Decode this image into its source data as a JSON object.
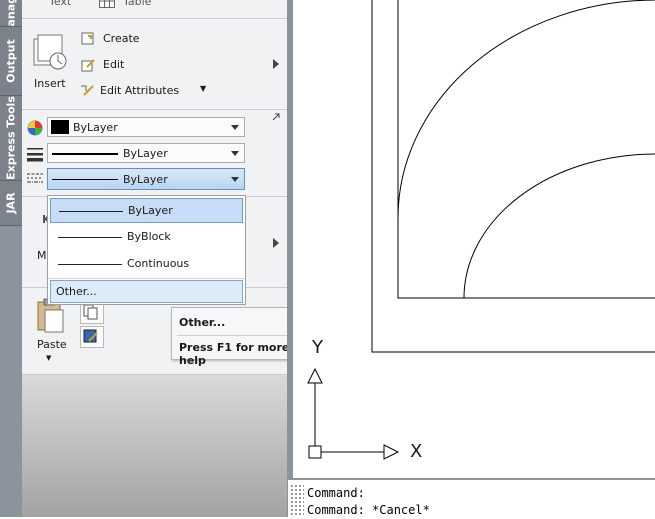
{
  "side_tabs": [
    "Manage",
    "Output",
    "Express Tools",
    "JAR"
  ],
  "top_partial": {
    "text_label": "Text",
    "table_label": "Table"
  },
  "block_panel": {
    "insert_label": "Insert",
    "create_label": "Create",
    "edit_label": "Edit",
    "edit_attributes_label": "Edit Attributes"
  },
  "properties_panel": {
    "color_value": "ByLayer",
    "lineweight_value": "ByLayer",
    "linetype_value": "ByLayer"
  },
  "linetype_dropdown": {
    "options": [
      "ByLayer",
      "ByBlock",
      "Continuous"
    ],
    "selected": "ByLayer",
    "other_label": "Other..."
  },
  "tooltip": {
    "title": "Other...",
    "help": "Press F1 for more help"
  },
  "partial_labels": {
    "match_label": "M"
  },
  "clipboard_panel": {
    "paste_label": "Paste"
  },
  "ucs": {
    "x_label": "X",
    "y_label": "Y"
  },
  "command_line": {
    "lines": [
      "Command:",
      "Command: *Cancel*"
    ]
  },
  "colors": {
    "selection": "#c6ddf5",
    "selection_border": "#6c9ed6",
    "tab_bg": "#7b828b"
  }
}
